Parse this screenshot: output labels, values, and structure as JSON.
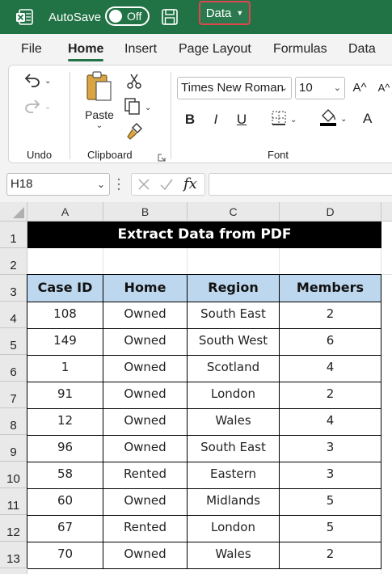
{
  "titlebar": {
    "autosave_label": "AutoSave",
    "autosave_state": "Off",
    "data_button_label": "Data",
    "bg_color": "#217346"
  },
  "ribbon_tabs": [
    {
      "label": "File",
      "active": false
    },
    {
      "label": "Home",
      "active": true
    },
    {
      "label": "Insert",
      "active": false
    },
    {
      "label": "Page Layout",
      "active": false
    },
    {
      "label": "Formulas",
      "active": false
    },
    {
      "label": "Data",
      "active": false
    }
  ],
  "ribbon": {
    "undo_group_label": "Undo",
    "clipboard_group_label": "Clipboard",
    "paste_label": "Paste",
    "font_group_label": "Font",
    "font_name": "Times New Roman",
    "font_size": "10",
    "grow_font_label": "A^",
    "shrink_font_label": "A^",
    "bold_label": "B",
    "italic_label": "I",
    "underline_label": "U",
    "font_color_label": "A",
    "font_color": "#ff0000"
  },
  "formula_bar": {
    "name_box": "H18",
    "fx_label": "fx",
    "formula": ""
  },
  "sheet": {
    "columns": [
      "A",
      "B",
      "C",
      "D"
    ],
    "rows": [
      "1",
      "2",
      "3",
      "4",
      "5",
      "6",
      "7",
      "8",
      "9",
      "10",
      "11",
      "12",
      "13"
    ],
    "title": "Extract Data from PDF",
    "headers": [
      "Case ID",
      "Home",
      "Region",
      "Members"
    ],
    "data": [
      [
        "108",
        "Owned",
        "South East",
        "2"
      ],
      [
        "149",
        "Owned",
        "South West",
        "6"
      ],
      [
        "1",
        "Owned",
        "Scotland",
        "4"
      ],
      [
        "91",
        "Owned",
        "London",
        "2"
      ],
      [
        "12",
        "Owned",
        "Wales",
        "4"
      ],
      [
        "96",
        "Owned",
        "South East",
        "3"
      ],
      [
        "58",
        "Rented",
        "Eastern",
        "3"
      ],
      [
        "60",
        "Owned",
        "Midlands",
        "5"
      ],
      [
        "67",
        "Rented",
        "London",
        "5"
      ],
      [
        "70",
        "Owned",
        "Wales",
        "2"
      ]
    ],
    "header_fill": "#bdd7ee",
    "title_fill": "#000000"
  }
}
